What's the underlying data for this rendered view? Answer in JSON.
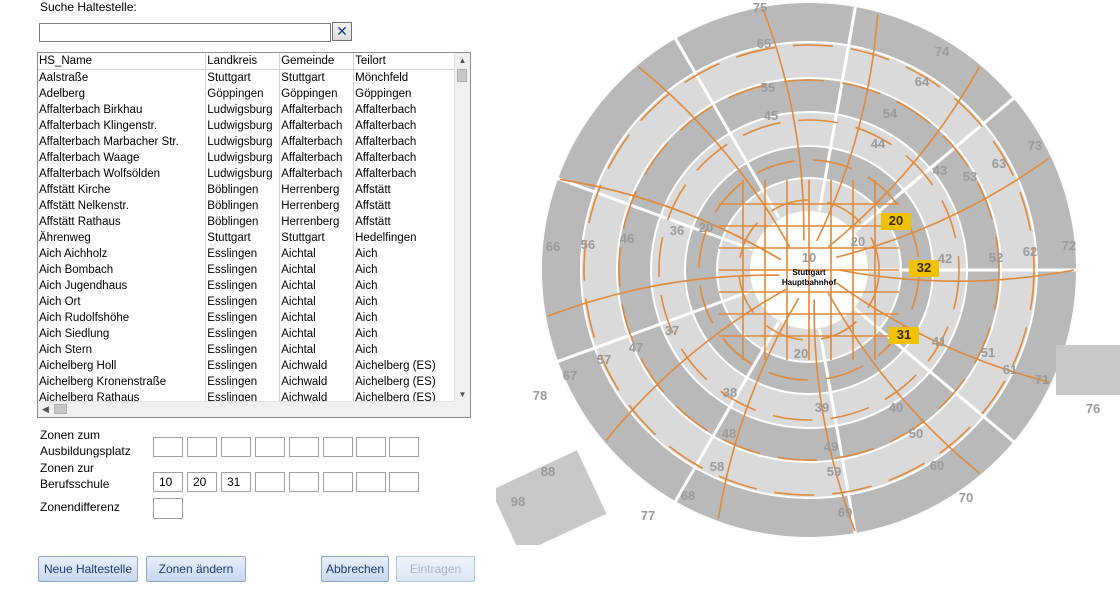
{
  "search": {
    "label": "Suche Haltestelle:",
    "value": "",
    "clear_icon": "close-x-icon"
  },
  "list": {
    "columns": [
      "HS_Name",
      "Landkreis",
      "Gemeinde",
      "Teilort"
    ],
    "rows": [
      [
        "Aalstraße",
        "Stuttgart",
        "Stuttgart",
        "Mönchfeld"
      ],
      [
        "Adelberg",
        "Göppingen",
        "Göppingen",
        "Göppingen"
      ],
      [
        "Affalterbach Birkhau",
        "Ludwigsburg",
        "Affalterbach",
        "Affalterbach"
      ],
      [
        "Affalterbach Klingenstr.",
        "Ludwigsburg",
        "Affalterbach",
        "Affalterbach"
      ],
      [
        "Affalterbach Marbacher Str.",
        "Ludwigsburg",
        "Affalterbach",
        "Affalterbach"
      ],
      [
        "Affalterbach Waage",
        "Ludwigsburg",
        "Affalterbach",
        "Affalterbach"
      ],
      [
        "Affalterbach Wolfsölden",
        "Ludwigsburg",
        "Affalterbach",
        "Affalterbach"
      ],
      [
        "Affstätt Kirche",
        "Böblingen",
        "Herrenberg",
        "Affstätt"
      ],
      [
        "Affstätt Nelkenstr.",
        "Böblingen",
        "Herrenberg",
        "Affstätt"
      ],
      [
        "Affstätt Rathaus",
        "Böblingen",
        "Herrenberg",
        "Affstätt"
      ],
      [
        "Ährenweg",
        "Stuttgart",
        "Stuttgart",
        "Hedelfingen"
      ],
      [
        "Aich Aichholz",
        "Esslingen",
        "Aichtal",
        "Aich"
      ],
      [
        "Aich Bombach",
        "Esslingen",
        "Aichtal",
        "Aich"
      ],
      [
        "Aich Jugendhaus",
        "Esslingen",
        "Aichtal",
        "Aich"
      ],
      [
        "Aich Ort",
        "Esslingen",
        "Aichtal",
        "Aich"
      ],
      [
        "Aich Rudolfshöhe",
        "Esslingen",
        "Aichtal",
        "Aich"
      ],
      [
        "Aich Siedlung",
        "Esslingen",
        "Aichtal",
        "Aich"
      ],
      [
        "Aich Stern",
        "Esslingen",
        "Aichtal",
        "Aich"
      ],
      [
        "Aichelberg Holl",
        "Esslingen",
        "Aichwald",
        "Aichelberg (ES)"
      ],
      [
        "Aichelberg Kronenstraße",
        "Esslingen",
        "Aichwald",
        "Aichelberg (ES)"
      ],
      [
        "Aichelberg Rathaus",
        "Esslingen",
        "Aichwald",
        "Aichelberg (ES)"
      ]
    ]
  },
  "zones": {
    "ausbildung_label": "Zonen zum\nAusbildungsplatz",
    "ausbildung_values": [
      "",
      "",
      "",
      "",
      "",
      "",
      "",
      ""
    ],
    "berufsschule_label": "Zonen zur\nBerufsschule",
    "berufsschule_values": [
      "10",
      "20",
      "31",
      "",
      "",
      "",
      "",
      ""
    ],
    "differenz_label": "Zonendifferenz",
    "differenz_value": ""
  },
  "buttons": {
    "neue": "Neue Haltestelle",
    "aendern": "Zonen ändern",
    "abbrechen": "Abbrechen",
    "eintragen": "Eintragen"
  },
  "map": {
    "center_label_1": "Stuttgart",
    "center_label_2": "Hauptbahnhof",
    "zone_numbers": [
      "10",
      "20",
      "20",
      "20",
      "20",
      "31",
      "32",
      "36",
      "37",
      "38",
      "39",
      "40",
      "41",
      "42",
      "43",
      "44",
      "45",
      "46",
      "47",
      "48",
      "49",
      "50",
      "51",
      "52",
      "53",
      "54",
      "55",
      "56",
      "57",
      "58",
      "59",
      "60",
      "61",
      "62",
      "63",
      "64",
      "65",
      "66",
      "67",
      "68",
      "69",
      "70",
      "71",
      "72",
      "73",
      "74",
      "75",
      "76",
      "77",
      "78",
      "88",
      "98"
    ],
    "highlighted_zones": [
      "20",
      "31",
      "32"
    ],
    "colors": {
      "highlight": "#f2c200",
      "lines": "#e0893a",
      "ring_dark": "#b9b9b9",
      "ring_light": "#dadada"
    }
  }
}
